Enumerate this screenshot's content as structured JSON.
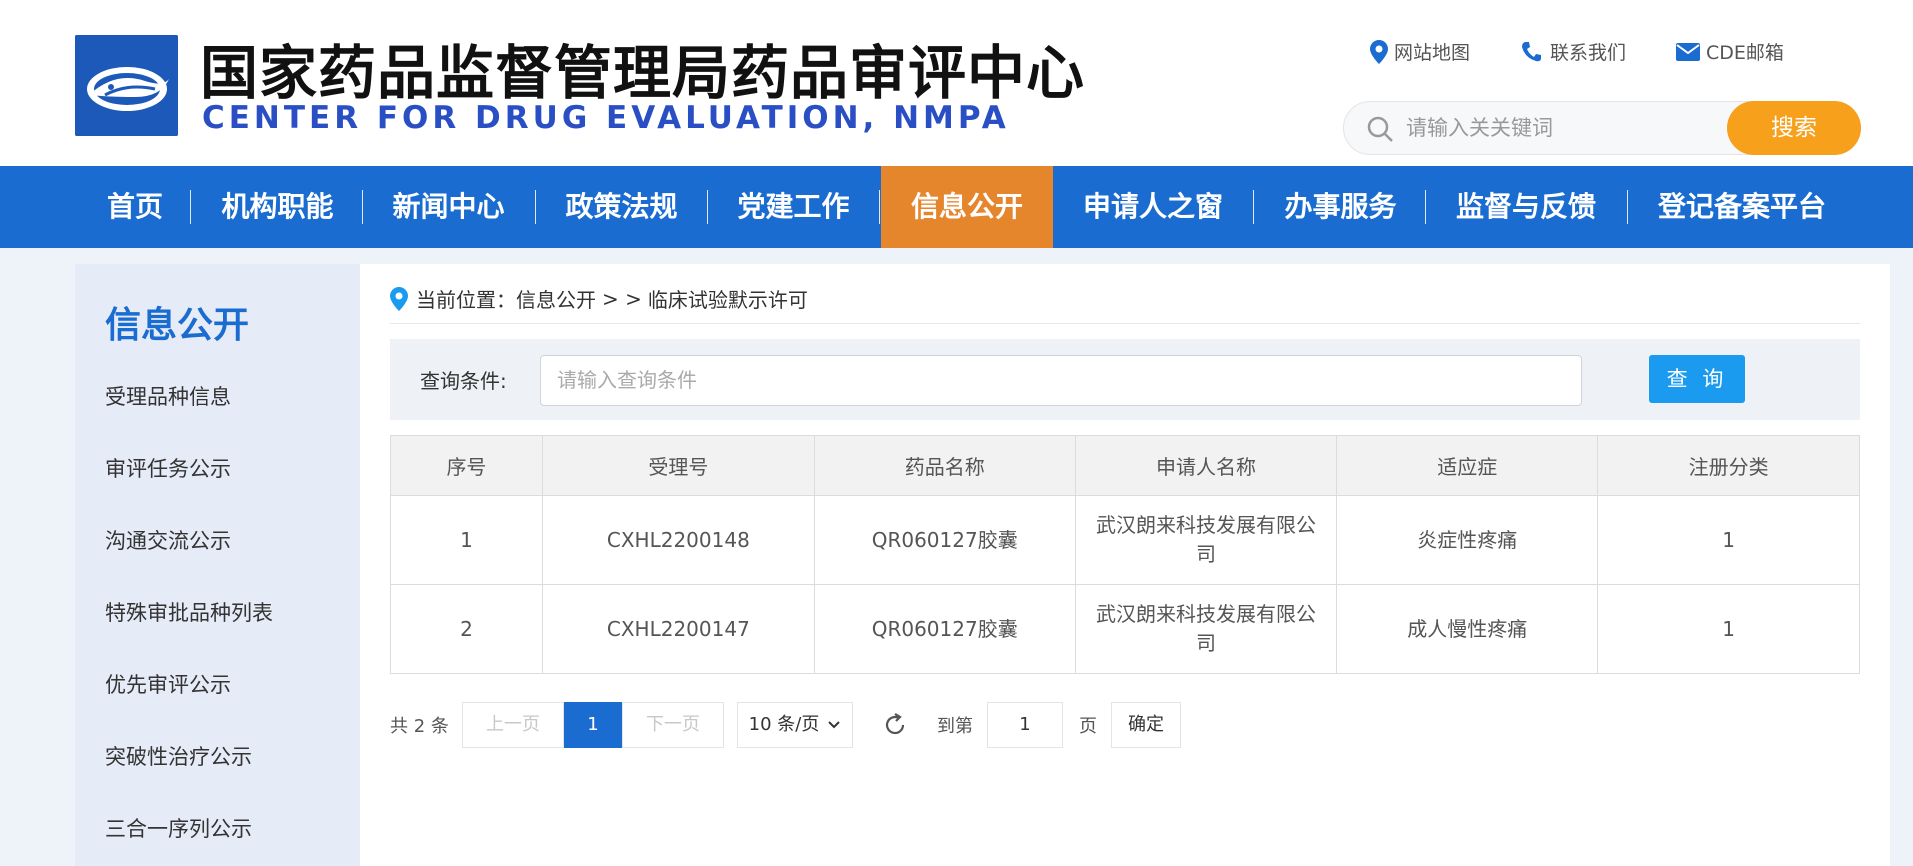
{
  "header": {
    "title": "国家药品监督管理局药品审评中心",
    "subtitle": "CENTER FOR DRUG EVALUATION, NMPA",
    "links": [
      {
        "label": "网站地图",
        "icon": "location-pin-icon"
      },
      {
        "label": "联系我们",
        "icon": "phone-icon"
      },
      {
        "label": "CDE邮箱",
        "icon": "mail-icon"
      }
    ],
    "search": {
      "placeholder": "请输入关关键词",
      "button_label": "搜索"
    }
  },
  "nav": {
    "items": [
      "首页",
      "机构职能",
      "新闻中心",
      "政策法规",
      "党建工作",
      "信息公开",
      "申请人之窗",
      "办事服务",
      "监督与反馈",
      "登记备案平台"
    ],
    "active": "信息公开"
  },
  "sidebar": {
    "title": "信息公开",
    "items": [
      "受理品种信息",
      "审评任务公示",
      "沟通交流公示",
      "特殊审批品种列表",
      "优先审评公示",
      "突破性治疗公示",
      "三合一序列公示"
    ]
  },
  "breadcrumb": {
    "prefix": "当前位置：",
    "path": [
      "信息公开",
      "临床试验默示许可"
    ],
    "sep": "> >"
  },
  "query": {
    "label": "查询条件:",
    "placeholder": "请输入查询条件",
    "button_label": "查 询"
  },
  "table": {
    "columns": [
      "序号",
      "受理号",
      "药品名称",
      "申请人名称",
      "适应症",
      "注册分类"
    ],
    "rows": [
      [
        "1",
        "CXHL2200148",
        "QR060127胶囊",
        "武汉朗来科技发展有限公司",
        "炎症性疼痛",
        "1"
      ],
      [
        "2",
        "CXHL2200147",
        "QR060127胶囊",
        "武汉朗来科技发展有限公司",
        "成人慢性疼痛",
        "1"
      ]
    ]
  },
  "pager": {
    "total": "共 2 条",
    "prev": "上一页",
    "current": "1",
    "next": "下一页",
    "page_size": "10 条/页",
    "goto_prefix": "到第",
    "goto_value": "1",
    "goto_suffix": "页",
    "confirm": "确定"
  },
  "colors": {
    "nav_bg": "#1b6cd1",
    "nav_active": "#e6862c",
    "search_button": "#f7a01b",
    "query_button": "#1b9bf0",
    "subtitle": "#2a4fc4"
  }
}
